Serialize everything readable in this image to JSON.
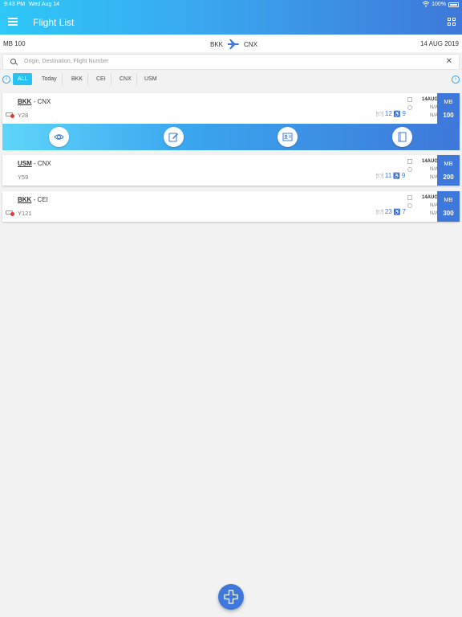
{
  "status_bar": {
    "time": "9:43 PM",
    "date": "Wed Aug 14",
    "battery": "100%"
  },
  "header": {
    "title": "Flight List"
  },
  "flight_info": {
    "flight_number": "MB 100",
    "origin": "BKK",
    "destination": "CNX",
    "date": "14 AUG 2019"
  },
  "search": {
    "placeholder": "Origin, Destination, Flight Number"
  },
  "filters": {
    "tabs": [
      "ALL",
      "Today",
      "BKK",
      "CEI",
      "CNX",
      "USM"
    ],
    "active": "ALL"
  },
  "flights": [
    {
      "origin": "BKK",
      "separator": "-",
      "destination": "CNX",
      "cabin": "Y28",
      "meals": "12",
      "wheelchairs": "9",
      "date": "14AUG",
      "std": "N/A",
      "etd": "N/A",
      "carrier": "MB",
      "number": "100",
      "baggage_alert": true
    },
    {
      "origin": "USM",
      "separator": "-",
      "destination": "CNX",
      "cabin": "Y59",
      "meals": "11",
      "wheelchairs": "9",
      "date": "14AUG",
      "std": "N/A",
      "etd": "N/A",
      "carrier": "MB",
      "number": "200",
      "baggage_alert": false
    },
    {
      "origin": "BKK",
      "separator": "-",
      "destination": "CEI",
      "cabin": "Y121",
      "meals": "23",
      "wheelchairs": "7",
      "date": "14AUG",
      "std": "N/A",
      "etd": "N/A",
      "carrier": "MB",
      "number": "300",
      "baggage_alert": true
    }
  ],
  "actions": [
    "eye-icon",
    "edit-icon",
    "id-card-icon",
    "book-icon"
  ],
  "colors": {
    "accent": "#3e78da",
    "cyan": "#27c2f1",
    "alert": "#e53935"
  }
}
